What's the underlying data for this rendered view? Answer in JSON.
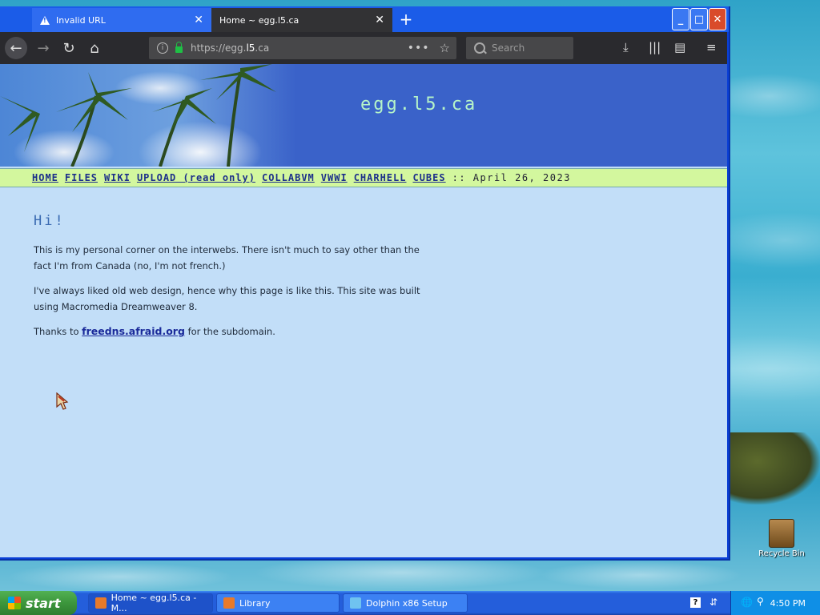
{
  "browser": {
    "tabs": [
      {
        "label": "Invalid URL",
        "active": false
      },
      {
        "label": "Home ~ egg.l5.ca",
        "active": true
      }
    ],
    "url_prefix": "https://egg.",
    "url_host": "l5",
    "url_suffix": ".ca",
    "search_placeholder": "Search"
  },
  "site": {
    "title": "egg.l5.ca",
    "nav": [
      "HOME",
      "FILES",
      "WIKI",
      "UPLOAD (read only)",
      "COLLABVM",
      "VWWI",
      "CHARHELL",
      "CUBES"
    ],
    "date": ":: April 26, 2023",
    "heading": "Hi!",
    "p1": "This is my personal corner on the interwebs. There isn't much to say other than the fact I'm from Canada (no, I'm not french.)",
    "p2": "I've always liked old web design, hence why this page is like this. This site was built using Macromedia Dreamweaver 8.",
    "p3_before": "Thanks to",
    "p3_link": "freedns.afraid.org",
    "p3_after": "for the subdomain."
  },
  "desktop": {
    "recycle_label": "Recycle Bin"
  },
  "taskbar": {
    "start": "start",
    "items": [
      "Home ~ egg.l5.ca - M...",
      "Library",
      "Dolphin x86 Setup"
    ],
    "clock": "4:50 PM"
  }
}
